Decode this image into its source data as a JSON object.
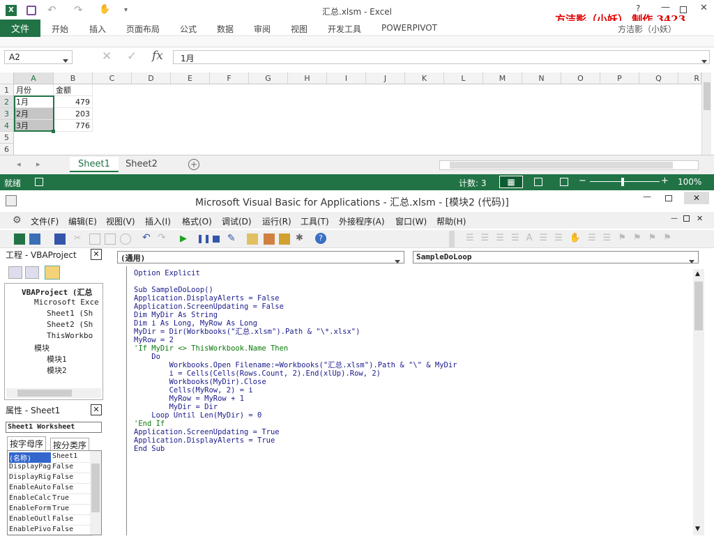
{
  "excel": {
    "title": "汇总.xlsm - Excel",
    "overlay_text": "方洁影（小妖） 制作 3423",
    "user": "方洁影（小妖）",
    "file_tab": "文件",
    "ribbon_tabs": [
      "开始",
      "插入",
      "页面布局",
      "公式",
      "数据",
      "审阅",
      "视图",
      "开发工具",
      "POWERPIVOT"
    ],
    "name_box": "A2",
    "formula_value": "1月",
    "columns": [
      "A",
      "B",
      "C",
      "D",
      "E",
      "F",
      "G",
      "H",
      "I",
      "J",
      "K",
      "L",
      "M",
      "N",
      "O",
      "P",
      "Q",
      "R"
    ],
    "rows": [
      "1",
      "2",
      "3",
      "4",
      "5",
      "6"
    ],
    "cells": {
      "A1": "月份",
      "B1": "金额",
      "A2": "1月",
      "B2": "479",
      "A3": "2月",
      "B3": "203",
      "A4": "3月",
      "B4": "776"
    },
    "sheets": [
      "Sheet1",
      "Sheet2"
    ],
    "status": {
      "ready": "就绪",
      "count": "计数: 3",
      "zoom": "100%"
    }
  },
  "vbe": {
    "title": "Microsoft Visual Basic for Applications - 汇总.xlsm - [模块2 (代码)]",
    "menus": [
      "文件(F)",
      "编辑(E)",
      "视图(V)",
      "插入(I)",
      "格式(O)",
      "调试(D)",
      "运行(R)",
      "工具(T)",
      "外接程序(A)",
      "窗口(W)",
      "帮助(H)"
    ],
    "project_title": "工程 - VBAProject",
    "tree": [
      {
        "label": "VBAProject (汇总",
        "level": 0
      },
      {
        "label": "Microsoft Exce",
        "level": 1
      },
      {
        "label": "Sheet1 (Sh",
        "level": 2
      },
      {
        "label": "Sheet2 (Sh",
        "level": 2
      },
      {
        "label": "ThisWorkbo",
        "level": 2
      },
      {
        "label": "模块",
        "level": 1
      },
      {
        "label": "模块1",
        "level": 2
      },
      {
        "label": "模块2",
        "level": 2
      }
    ],
    "props_title": "属性 - Sheet1",
    "props_object": "Sheet1 Worksheet",
    "props_tabs": [
      "按字母序",
      "按分类序"
    ],
    "props": [
      {
        "k": "(名称)",
        "v": "Sheet1"
      },
      {
        "k": "DisplayPag",
        "v": "False"
      },
      {
        "k": "DisplayRig",
        "v": "False"
      },
      {
        "k": "EnableAuto",
        "v": "False"
      },
      {
        "k": "EnableCalc",
        "v": "True"
      },
      {
        "k": "EnableForm",
        "v": "True"
      },
      {
        "k": "EnableOutl",
        "v": "False"
      },
      {
        "k": "EnablePivo",
        "v": "False"
      }
    ],
    "combo_left": "(通用)",
    "combo_right": "SampleDoLoop",
    "code": [
      "Option Explicit",
      "",
      "Sub SampleDoLoop()",
      "Application.DisplayAlerts = False",
      "Application.ScreenUpdating = False",
      "Dim MyDir As String",
      "Dim i As Long, MyRow As Long",
      "MyDir = Dir(Workbooks(\"汇总.xlsm\").Path & \"\\*.xlsx\")",
      "MyRow = 2",
      "'If MyDir <> ThisWorkbook.Name Then",
      "    Do",
      "        Workbooks.Open Filename:=Workbooks(\"汇总.xlsm\").Path & \"\\\" & MyDir",
      "        i = Cells(Cells(Rows.Count, 2).End(xlUp).Row, 2)",
      "        Workbooks(MyDir).Close",
      "        Cells(MyRow, 2) = i",
      "        MyRow = MyRow + 1",
      "        MyDir = Dir",
      "    Loop Until Len(MyDir) = 0",
      "'End If",
      "Application.ScreenUpdating = True",
      "Application.DisplayAlerts = True",
      "End Sub"
    ]
  }
}
